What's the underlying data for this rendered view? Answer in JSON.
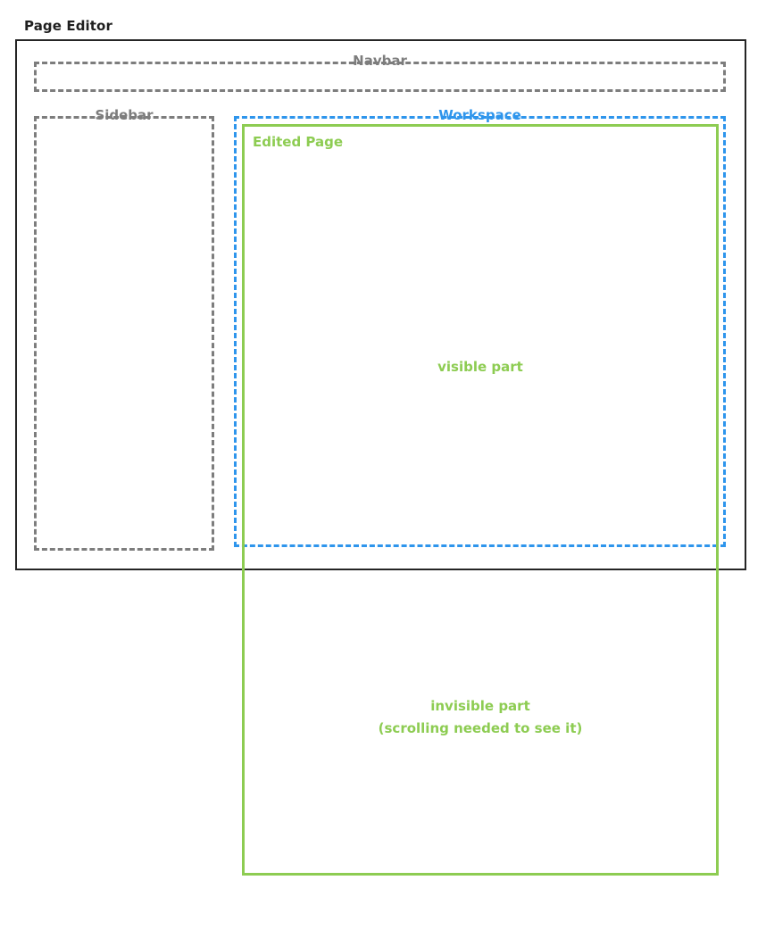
{
  "page": {
    "title": "Page Editor"
  },
  "colors": {
    "frame": "#252525",
    "region_gray": "#7d7d7d",
    "workspace_blue": "#2e95ec",
    "edited_page_green": "#8dcc52",
    "background": "#ffffff"
  },
  "regions": {
    "navbar": {
      "label": "Navbar"
    },
    "sidebar": {
      "label": "Sidebar"
    },
    "workspace": {
      "label": "Workspace"
    }
  },
  "edited_page": {
    "label": "Edited Page",
    "visible_part": {
      "label": "visible part"
    },
    "invisible_part": {
      "line1": "invisible part",
      "line2": "(scrolling needed to see it)"
    }
  }
}
